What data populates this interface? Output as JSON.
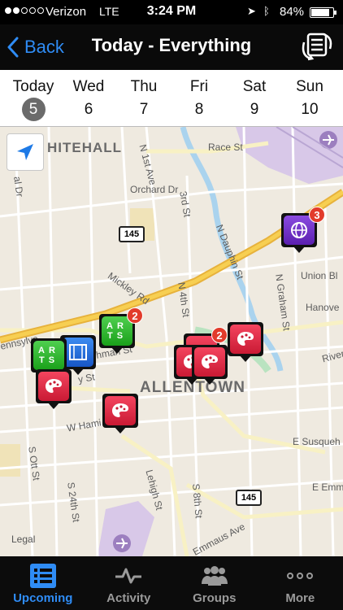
{
  "status_bar": {
    "carrier": "Verizon",
    "network": "LTE",
    "time": "3:24 PM",
    "battery": "84%",
    "battery_level": 0.84
  },
  "navbar": {
    "back_label": "Back",
    "title": "Today - Everything"
  },
  "days": [
    {
      "name": "Today",
      "num": "5",
      "selected": true
    },
    {
      "name": "Wed",
      "num": "6"
    },
    {
      "name": "Thu",
      "num": "7"
    },
    {
      "name": "Fri",
      "num": "8"
    },
    {
      "name": "Sat",
      "num": "9"
    },
    {
      "name": "Sun",
      "num": "10"
    }
  ],
  "map": {
    "city_label": "ALLENTOWN",
    "district_label": "HITEHALL",
    "legal_label": "Legal",
    "route_shield": "145",
    "street_labels": {
      "race": "Race St",
      "first": "N 1st Ave",
      "orchard": "Orchard Dr",
      "third": "3rd St",
      "dauphin": "N Dauphin St",
      "mickley": "Mickley Rd",
      "fourth": "N 4th St",
      "graham": "N Graham St",
      "union": "Union Bl",
      "hanover": "Hanove",
      "river": "River",
      "pennsylvania": "ennsylva",
      "richmond": "hman St",
      "city_st": "y St",
      "hamilton": "W Hami",
      "ott": "S Ott St",
      "s24": "S 24th St",
      "lehigh": "Lehigh St",
      "s8": "S 8th St",
      "susq": "E Susqueh",
      "emmaus": "Emmaus Ave",
      "emm": "E Emm",
      "dr": "al Dr"
    },
    "pins": {
      "arts_top_badge": "2",
      "cluster_badge": "2",
      "globe_badge": "3",
      "arts_label_top": "AR",
      "arts_label_bottom": "TS"
    }
  },
  "tabs": [
    {
      "label": "Upcoming",
      "icon": "list-icon",
      "active": true
    },
    {
      "label": "Activity",
      "icon": "pulse-icon"
    },
    {
      "label": "Groups",
      "icon": "groups-icon"
    },
    {
      "label": "More",
      "icon": "more-icon"
    }
  ],
  "colors": {
    "accent": "#2f8cf5",
    "arts": "#2bb52b",
    "palette": "#e8304c",
    "film": "#2f6fe0",
    "globe": "#7a3ad0",
    "badge": "#e23b2b"
  }
}
